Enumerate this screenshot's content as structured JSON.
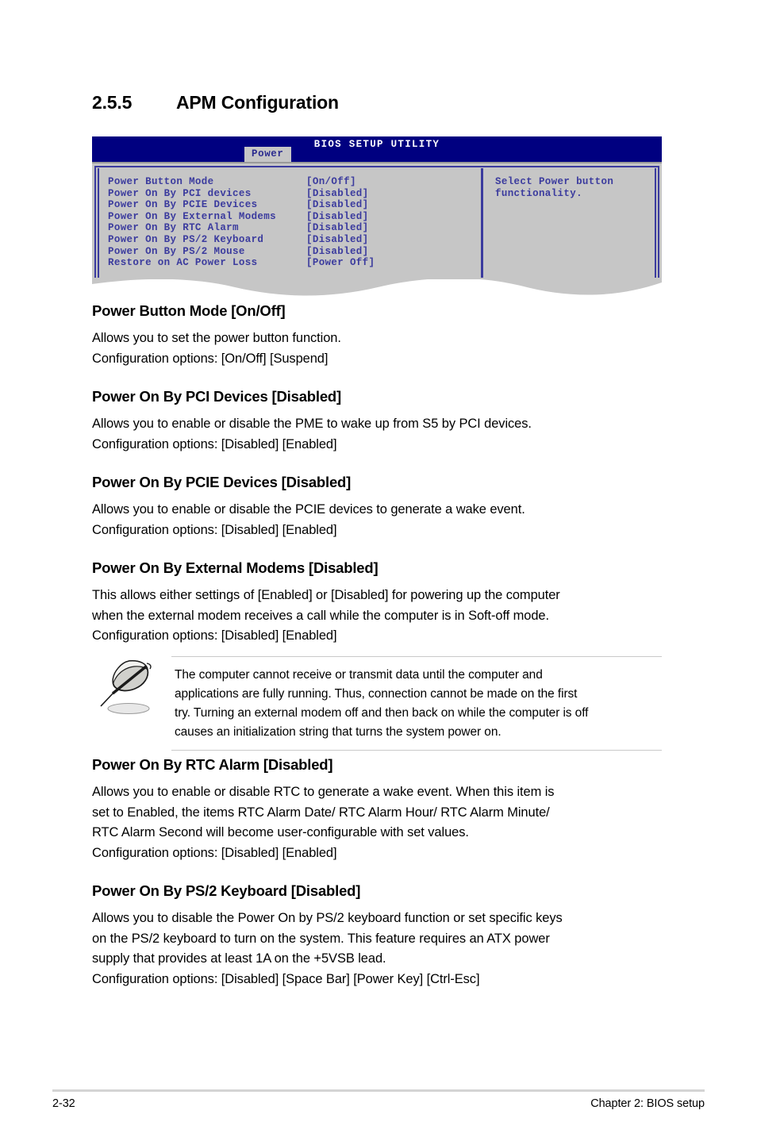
{
  "page": {
    "heading_number": "2.5.5",
    "heading_title": "APM Configuration",
    "footer_page": "2-32",
    "footer_chapter": "Chapter 2: BIOS setup"
  },
  "bios": {
    "title": "BIOS SETUP UTILITY",
    "active_tab": "Power",
    "colors": {
      "titlebar": "#000080",
      "panel": "#c6c6c6",
      "text": "#3b3b9e",
      "border": "#3b3b9e"
    },
    "items": [
      {
        "label": "Power Button Mode",
        "value": "[On/Off]"
      },
      {
        "label": "Power On By PCI devices",
        "value": "[Disabled]"
      },
      {
        "label": "Power On By PCIE Devices",
        "value": "[Disabled]"
      },
      {
        "label": "Power On By External Modems",
        "value": "[Disabled]"
      },
      {
        "label": "Power On By RTC Alarm",
        "value": "[Disabled]"
      },
      {
        "label": "Power On By PS/2 Keyboard",
        "value": "[Disabled]"
      },
      {
        "label": "Power On By PS/2 Mouse",
        "value": "[Disabled]"
      },
      {
        "label": "Restore on AC Power Loss",
        "value": "[Power Off]"
      }
    ],
    "help_text": "Select Power button\nfunctionality."
  },
  "sections": [
    {
      "title": "Power Button Mode [On/Off]",
      "lines": [
        "Allows you to set the power button function.",
        "Configuration options: [On/Off] [Suspend]"
      ]
    },
    {
      "title": "Power On By PCI Devices [Disabled]",
      "lines": [
        "Allows you to enable or disable the PME to wake up from S5 by PCI devices.",
        "Configuration options: [Disabled] [Enabled]"
      ]
    },
    {
      "title": "Power On By PCIE Devices [Disabled]",
      "lines": [
        "Allows you to enable or disable the PCIE devices to generate a wake event.",
        "Configuration options: [Disabled] [Enabled]"
      ]
    },
    {
      "title": "Power On By External Modems [Disabled]",
      "lines": [
        "This allows either settings of [Enabled] or [Disabled] for powering up the computer",
        "when the external modem receives a call while the computer is in Soft-off mode.",
        "Configuration options: [Disabled] [Enabled]"
      ]
    },
    {
      "title": "Power On By RTC Alarm [Disabled]",
      "lines": [
        "Allows you to enable or disable RTC to generate a wake event. When this item is",
        "set to Enabled, the items RTC Alarm Date/ RTC Alarm Hour/ RTC Alarm Minute/",
        "RTC Alarm Second will become user-configurable with set values.",
        "Configuration options: [Disabled] [Enabled]"
      ]
    },
    {
      "title": "Power On By PS/2 Keyboard [Disabled]",
      "lines": [
        "Allows you to disable the Power On by PS/2 keyboard function or set specific keys",
        "on the PS/2 keyboard to turn on the system. This feature requires an ATX power",
        "supply that provides at least 1A on the +5VSB lead.",
        "Configuration options: [Disabled] [Space Bar] [Power Key] [Ctrl-Esc]"
      ]
    }
  ],
  "note": {
    "icon": "quill-pen-icon",
    "lines": [
      "The computer cannot receive or transmit data until the computer and",
      "applications are fully running. Thus, connection cannot be made on the first",
      "try. Turning an external modem off and then back on while the computer is off",
      "causes an initialization string that turns the system power on."
    ]
  }
}
